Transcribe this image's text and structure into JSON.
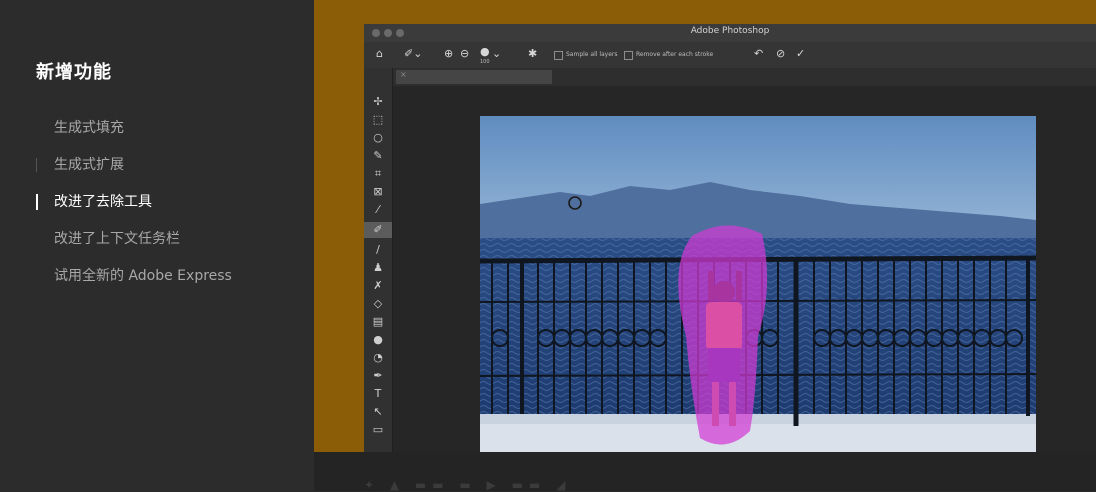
{
  "sidebar": {
    "title": "新增功能",
    "items": [
      {
        "label": "生成式填充"
      },
      {
        "label": "生成式扩展"
      },
      {
        "label": "改进了去除工具"
      },
      {
        "label": "改进了上下文任务栏"
      },
      {
        "label": "试用全新的 Adobe Express"
      }
    ]
  },
  "photoshop": {
    "app_title": "Adobe Photoshop",
    "options": {
      "sample_all_layers": "Sample all layers",
      "remove_after_each_stroke": "Remove after each stroke",
      "brush_size": "100"
    }
  },
  "colors": {
    "sidebar_bg": "#2c2c2c",
    "stage_bg": "#8a5d06",
    "active_item": "#ffffff",
    "inactive_item": "#a8a8a8",
    "remove_mask": "#cc33cc"
  }
}
